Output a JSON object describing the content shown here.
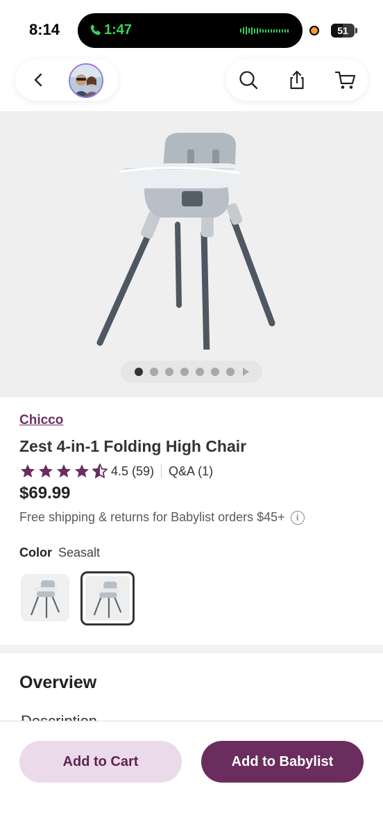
{
  "status_bar": {
    "time": "8:14",
    "call_timer": "1:47",
    "battery": "51"
  },
  "nav": {
    "back_icon": "chevron-left-icon",
    "search_icon": "search-icon",
    "share_icon": "share-icon",
    "cart_icon": "cart-icon"
  },
  "gallery": {
    "image_count": 7,
    "active_index": 0
  },
  "product": {
    "brand": "Chicco",
    "title": "Zest 4-in-1 Folding High Chair",
    "rating": 4.5,
    "rating_text": "4.5 (59)",
    "qa_text": "Q&A (1)",
    "price": "$69.99",
    "shipping": "Free shipping & returns for Babylist orders $45+",
    "color_label": "Color",
    "color_value": "Seasalt",
    "selected_swatch_index": 1
  },
  "overview": {
    "heading": "Overview",
    "description_label": "Description"
  },
  "actions": {
    "add_to_cart": "Add to Cart",
    "add_to_babylist": "Add to Babylist"
  },
  "colors": {
    "brand_purple": "#6a2d5e",
    "light_purple": "#ebdbea",
    "call_green": "#36d35b"
  }
}
